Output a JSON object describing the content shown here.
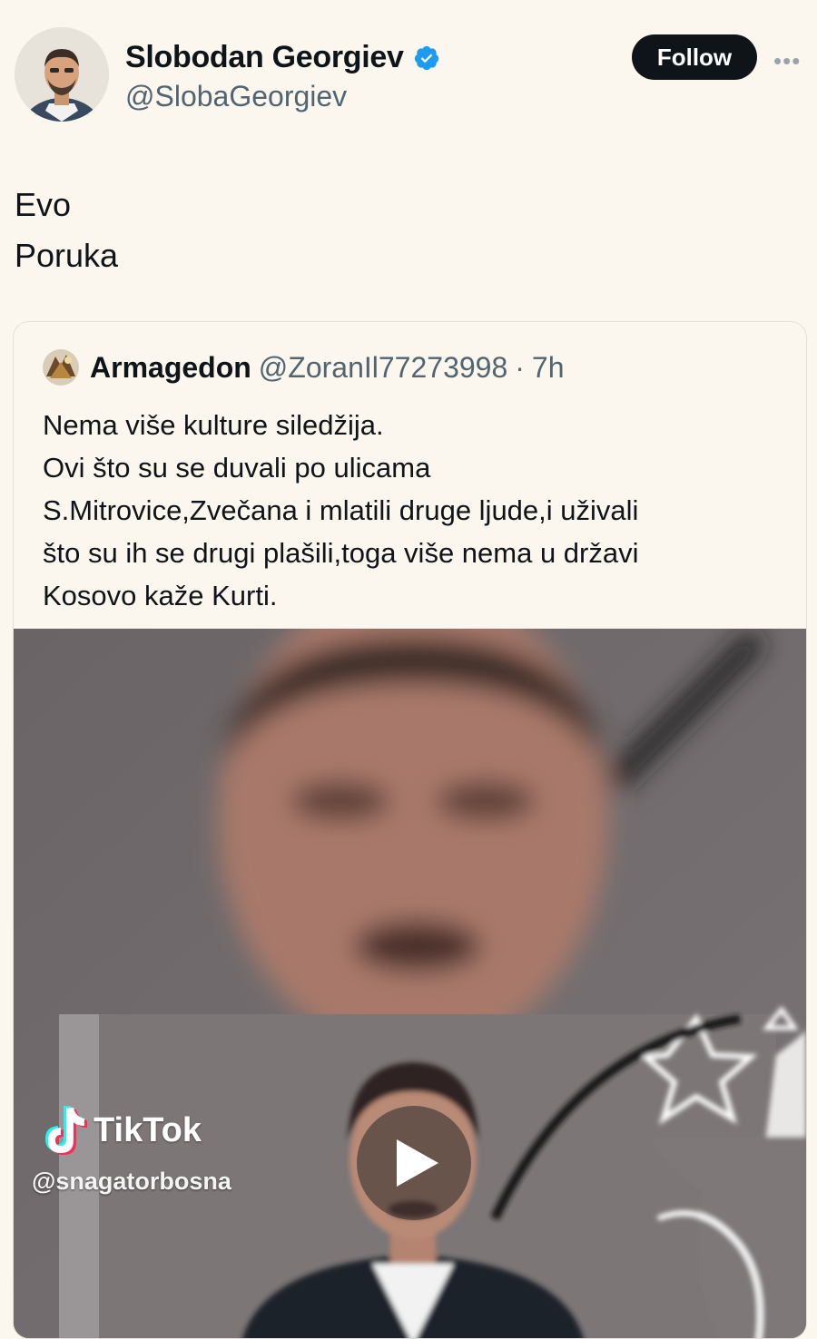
{
  "author": {
    "display_name": "Slobodan Georgiev",
    "handle": "@SlobaGeorgiev",
    "verified": true
  },
  "actions": {
    "follow_label": "Follow",
    "more_icon": "ellipsis-icon"
  },
  "tweet": {
    "lines": [
      "Evo",
      "Poruka"
    ]
  },
  "quote": {
    "display_name": "Armagedon",
    "handle": "@ZoranIl77273998",
    "separator": "·",
    "time": "7h",
    "lines": [
      "Nema više kulture siledžija.",
      "Ovi što su se duvali po  ulicama",
      "S.Mitrovice,Zvečana i mlatili druge ljude,i uživali",
      "što su ih se drugi plašili,toga više nema u državi",
      "Kosovo kaže Kurti."
    ],
    "media": {
      "watermark": "TikTok",
      "watermark_user": "@snagatorbosna",
      "play_icon": "play-icon"
    }
  },
  "colors": {
    "background": "#fbf7ee",
    "text": "#0f1419",
    "secondary_text": "#536471",
    "verified_blue": "#1d9bf0",
    "follow_bg": "#0f1419"
  }
}
